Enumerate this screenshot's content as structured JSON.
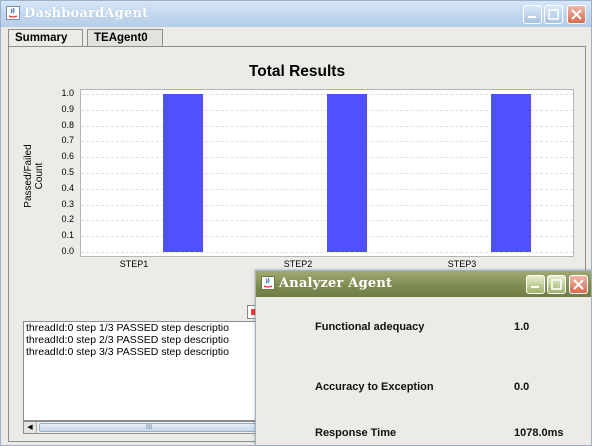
{
  "main_window": {
    "title": "DashboardAgent",
    "tabs": [
      {
        "label": "Summary",
        "active": true
      },
      {
        "label": "TEAgent0",
        "active": false
      }
    ]
  },
  "chart_data": {
    "type": "bar",
    "title": "Total Results",
    "xlabel": "",
    "ylabel": "Passed/Failed Count",
    "categories": [
      "STEP1",
      "STEP2",
      "STEP3"
    ],
    "series": [
      {
        "values": [
          1.0,
          1.0,
          1.0
        ],
        "color": "#5050ff"
      }
    ],
    "ylim": [
      0.0,
      1.0
    ],
    "yticks": [
      "0.0",
      "0.1",
      "0.2",
      "0.3",
      "0.4",
      "0.5",
      "0.6",
      "0.7",
      "0.8",
      "0.9",
      "1.0"
    ],
    "grid": true
  },
  "log_lines": [
    "threadId:0 step 1/3 PASSED step descriptio",
    "threadId:0 step 2/3 PASSED step descriptio",
    "threadId:0 step 3/3 PASSED step descriptio"
  ],
  "analyzer_window": {
    "title": "Analyzer Agent",
    "metrics": [
      {
        "label": "Functional adequacy",
        "value": "1.0"
      },
      {
        "label": "Accuracy to Exception",
        "value": "0.0"
      },
      {
        "label": "Response Time",
        "value": "1078.0ms"
      }
    ]
  },
  "scrollbar": {
    "thumb_glyph": "III"
  }
}
